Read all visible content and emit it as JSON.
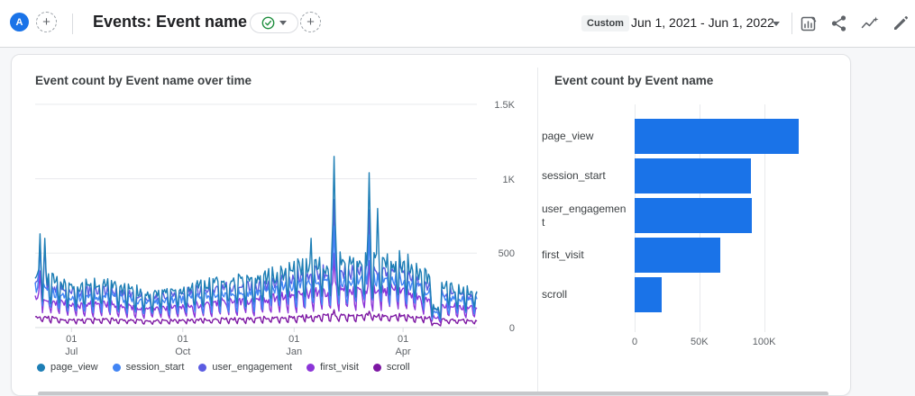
{
  "header": {
    "avatar_label": "A",
    "add_icon": "+",
    "title": "Events: Event name",
    "range_type": "Custom",
    "date_range": "Jun 1, 2021 - Jun 1, 2022"
  },
  "colors": {
    "accent_blue": "#1a73e8",
    "check_green": "#1e8e3e",
    "icon_gray": "#5f6368",
    "gridline": "#e8eaed",
    "axis_line": "#dadce0"
  },
  "chart_data": [
    {
      "type": "line",
      "title": "Event count by Event name over time",
      "x_range": [
        "Jun 1, 2021",
        "Jun 1, 2022"
      ],
      "days": 365,
      "ylim": [
        0,
        1550
      ],
      "y_ticks": [
        {
          "value": 0,
          "label": "0"
        },
        {
          "value": 500,
          "label": "500"
        },
        {
          "value": 1000,
          "label": "1K"
        },
        {
          "value": 1500,
          "label": "1.5K"
        }
      ],
      "x_ticks": [
        {
          "day": 30,
          "label": "01",
          "sublabel": "Jul"
        },
        {
          "day": 122,
          "label": "01",
          "sublabel": "Oct"
        },
        {
          "day": 214,
          "label": "01",
          "sublabel": "Jan"
        },
        {
          "day": 304,
          "label": "01",
          "sublabel": "Apr"
        }
      ],
      "legend_position": "bottom",
      "grid": true,
      "weekly_pattern": [
        1.0,
        0.95,
        0.9,
        0.92,
        0.97,
        0.62,
        0.48
      ],
      "noise": 0.13,
      "dip": {
        "start": 328,
        "end": 335,
        "factor": 0.45
      },
      "series": [
        {
          "name": "page_view",
          "color": "#1d7eb5",
          "monthly_levels": [
            380,
            300,
            310,
            240,
            280,
            330,
            340,
            420,
            460,
            470,
            460,
            300,
            250
          ],
          "spikes": [
            {
              "day": 4,
              "value": 630
            },
            {
              "day": 8,
              "value": 600
            },
            {
              "day": 228,
              "value": 600
            },
            {
              "day": 247,
              "value": 1150
            },
            {
              "day": 276,
              "value": 1040
            },
            {
              "day": 283,
              "value": 800
            }
          ]
        },
        {
          "name": "session_start",
          "color": "#4285f4",
          "monthly_levels": [
            280,
            220,
            230,
            180,
            210,
            240,
            250,
            310,
            340,
            350,
            340,
            220,
            190
          ],
          "spikes": [
            {
              "day": 4,
              "value": 560
            },
            {
              "day": 247,
              "value": 680
            },
            {
              "day": 276,
              "value": 620
            }
          ]
        },
        {
          "name": "user_engagement",
          "color": "#5b5ce2",
          "monthly_levels": [
            330,
            260,
            270,
            210,
            240,
            280,
            290,
            360,
            400,
            410,
            400,
            260,
            220
          ],
          "spikes": [
            {
              "day": 4,
              "value": 600
            },
            {
              "day": 8,
              "value": 570
            },
            {
              "day": 247,
              "value": 860
            },
            {
              "day": 276,
              "value": 790
            }
          ]
        },
        {
          "name": "first_visit",
          "color": "#8c35d8",
          "monthly_levels": [
            210,
            160,
            170,
            130,
            150,
            180,
            190,
            240,
            260,
            270,
            260,
            160,
            140
          ],
          "spikes": [
            {
              "day": 4,
              "value": 380
            },
            {
              "day": 247,
              "value": 500
            },
            {
              "day": 276,
              "value": 450
            }
          ]
        },
        {
          "name": "scroll",
          "color": "#7d17a3",
          "monthly_levels": [
            80,
            55,
            60,
            50,
            55,
            60,
            65,
            75,
            85,
            90,
            85,
            60,
            50
          ],
          "spikes": [
            {
              "day": 247,
              "value": 120
            },
            {
              "day": 276,
              "value": 110
            }
          ]
        }
      ]
    },
    {
      "type": "bar",
      "orientation": "horizontal",
      "title": "Event count by Event name",
      "categories": [
        "page_view",
        "session_start",
        "user_engagement",
        "first_visit",
        "scroll"
      ],
      "values": [
        127000,
        90000,
        90500,
        66000,
        21000
      ],
      "xlim": [
        0,
        158000
      ],
      "x_ticks": [
        {
          "value": 0,
          "label": "0"
        },
        {
          "value": 50000,
          "label": "50K"
        },
        {
          "value": 100000,
          "label": "100K"
        }
      ],
      "bar_color": "#1a73e8",
      "grid": true
    }
  ]
}
